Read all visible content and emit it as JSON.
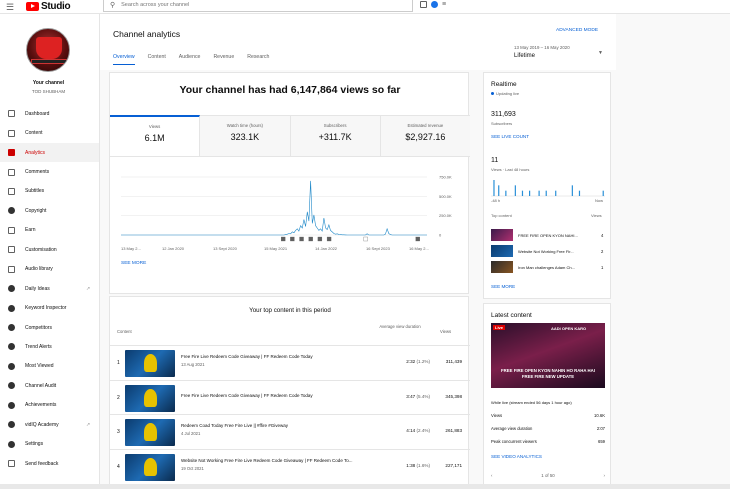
{
  "header": {
    "logo_text": "Studio",
    "search_placeholder": "Search across your channel"
  },
  "sidebar": {
    "channel_label": "Your channel",
    "channel_name": "TOD SHUBHAM",
    "items": [
      {
        "label": "Dashboard",
        "icon": "dashboard-icon"
      },
      {
        "label": "Content",
        "icon": "content-icon"
      },
      {
        "label": "Analytics",
        "icon": "analytics-icon"
      },
      {
        "label": "Comments",
        "icon": "comments-icon"
      },
      {
        "label": "Subtitles",
        "icon": "subtitles-icon"
      },
      {
        "label": "Copyright",
        "icon": "copyright-icon"
      },
      {
        "label": "Earn",
        "icon": "earn-icon"
      },
      {
        "label": "Customisation",
        "icon": "customisation-icon"
      },
      {
        "label": "Audio library",
        "icon": "audio-library-icon"
      },
      {
        "label": "Daily Ideas",
        "icon": "vidiq-icon"
      },
      {
        "label": "Keyword Inspector",
        "icon": "vidiq-icon"
      },
      {
        "label": "Competitors",
        "icon": "vidiq-icon"
      },
      {
        "label": "Trend Alerts",
        "icon": "vidiq-icon"
      },
      {
        "label": "Most Viewed",
        "icon": "vidiq-icon"
      },
      {
        "label": "Channel Audit",
        "icon": "vidiq-icon"
      },
      {
        "label": "Achievements",
        "icon": "vidiq-icon"
      },
      {
        "label": "vidIQ Academy",
        "icon": "vidiq-icon"
      },
      {
        "label": "Settings",
        "icon": "settings-icon"
      },
      {
        "label": "Send feedback",
        "icon": "feedback-icon"
      }
    ],
    "active": "Analytics"
  },
  "main": {
    "title": "Channel analytics",
    "tabs": [
      "Overview",
      "Content",
      "Audience",
      "Revenue",
      "Research"
    ],
    "advanced_mode": "ADVANCED MODE",
    "date_range": "13 May 2019 – 16 May 2020",
    "period": "Lifetime",
    "headline": "Your channel has had 6,147,864 views so far",
    "metrics": [
      {
        "label": "Views",
        "value": "6.1M"
      },
      {
        "label": "Watch time (hours)",
        "value": "323.1K"
      },
      {
        "label": "Subscribers",
        "value": "+311.7K"
      },
      {
        "label": "Estimated revenue",
        "value": "$2,927.16"
      }
    ],
    "see_more": "SEE MORE",
    "top_content_title": "Your top content in this period",
    "col_content": "Content",
    "col_avd": "Average view duration",
    "col_views": "Views",
    "top_rows": [
      {
        "num": "1",
        "title": "Free Fire Live Redeem Code Giveaway | FF Redeem Code Today",
        "date": "13 Aug 2021",
        "duration": "2:32",
        "pct": "(1.2%)",
        "views": "311,439"
      },
      {
        "num": "2",
        "title": "Free Fire Live Redeem Code Giveaway | FF Redeem Code Today",
        "date": "",
        "duration": "3:47",
        "pct": "(5.4%)",
        "views": "345,398"
      },
      {
        "num": "3",
        "title": "Redeem Coad Today Free Fire Live || #ffire #Giveway",
        "date": "4 Jul 2021",
        "duration": "4:14",
        "pct": "(2.4%)",
        "views": "261,883"
      },
      {
        "num": "4",
        "title": "Website Not Working Free Fire Live Redeem Code Giveaway | FF Redeem Code To...",
        "date": "19 Oct 2021",
        "duration": "1:38",
        "pct": "(1.6%)",
        "views": "227,171"
      }
    ]
  },
  "chart_data": {
    "type": "line",
    "x_ticks": [
      "13 May 2...",
      "12 Jan 2020",
      "13 Sept 2020",
      "15 May 2021",
      "14 Jan 2022",
      "16 Sept 2023",
      "16 May 2..."
    ],
    "y_ticks": [
      "750.0K",
      "500.0K",
      "250.0K",
      "0"
    ],
    "ylim": [
      0,
      750000
    ],
    "series": [
      {
        "values": [
          0,
          0,
          0,
          0,
          0,
          0,
          0,
          0,
          0,
          0,
          0,
          0,
          0,
          0,
          0,
          0,
          0,
          0,
          0,
          0,
          0,
          0,
          0,
          0,
          0,
          0,
          0,
          0,
          0,
          0,
          0,
          0,
          0,
          0,
          0,
          0,
          0,
          0,
          0,
          0,
          0,
          0,
          0,
          0,
          0,
          0,
          0,
          0,
          0,
          0,
          0,
          0,
          0,
          0,
          0,
          0,
          0,
          0,
          0,
          0,
          0,
          0,
          0,
          0,
          0,
          0,
          0,
          0,
          0,
          0,
          0,
          0,
          0,
          0,
          0,
          0,
          0,
          0,
          0,
          0,
          0,
          0,
          0,
          0,
          0,
          0,
          0,
          0,
          0,
          0,
          0,
          0,
          0,
          0,
          0,
          0,
          0,
          0,
          0,
          5000,
          10000,
          20000,
          15000,
          40000,
          30000,
          60000,
          80000,
          50000,
          120000,
          90000,
          200000,
          110000,
          300000,
          180000,
          700000,
          150000,
          260000,
          120000,
          90000,
          60000,
          80000,
          50000,
          220000,
          90000,
          70000,
          130000,
          60000,
          40000,
          20000,
          10000,
          15000,
          8000,
          5000,
          3000,
          2000,
          1000,
          0,
          0,
          0,
          0,
          0,
          0,
          0,
          0,
          0,
          0,
          0,
          0,
          15000,
          0,
          0,
          0,
          0,
          0,
          0,
          0,
          0,
          0,
          0,
          10000,
          80000,
          20000,
          5000,
          0,
          0,
          0,
          0,
          0,
          0,
          0,
          0,
          0,
          0,
          0,
          0,
          0,
          0,
          0,
          0,
          0,
          0,
          0,
          0,
          0,
          0
        ]
      }
    ]
  },
  "realtime": {
    "title": "Realtime",
    "updating": "Updating live",
    "subscribers": "311,693",
    "subscribers_label": "Subscribers",
    "see_live_count": "SEE LIVE COUNT",
    "views": "11",
    "views_label": "Views · Last 48 hours",
    "axis_left": "-48 h",
    "axis_right": "Now",
    "top_content_label": "Top content",
    "views_col": "Views",
    "bars": [
      0,
      3,
      0,
      2,
      0,
      0,
      1,
      0,
      0,
      0,
      2,
      0,
      0,
      1,
      0,
      0,
      1,
      0,
      0,
      0,
      1,
      0,
      0,
      1,
      0,
      0,
      0,
      1,
      0,
      0,
      0,
      0,
      0,
      0,
      2,
      0,
      0,
      1,
      0,
      0,
      0,
      0,
      0,
      0,
      0,
      0,
      0,
      1
    ],
    "top": [
      {
        "title": "FREE FIRE OPEN KYON NAHI...",
        "views": "4"
      },
      {
        "title": "Website Not Working Free Fir...",
        "views": "2"
      },
      {
        "title": "Iron Man challenges Adam Ch...",
        "views": "1"
      }
    ],
    "see_more": "SEE MORE"
  },
  "latest": {
    "title": "Latest content",
    "live_badge": "Live",
    "thumb_top": "AADI OPEN KARO",
    "thumb_caption": "FREE FIRE OPEN KYON NAHIN HO RAHA HAI FREE FIRE NEW UPDATE",
    "meta": "While live (stream ended 56 days 1 hour ago)",
    "stats": [
      {
        "label": "Views",
        "value": "10.6K"
      },
      {
        "label": "Average view duration",
        "value": "2:07"
      },
      {
        "label": "Peak concurrent viewers",
        "value": "659"
      }
    ],
    "see_video_analytics": "SEE VIDEO ANALYTICS",
    "pager": "1 of 50"
  }
}
